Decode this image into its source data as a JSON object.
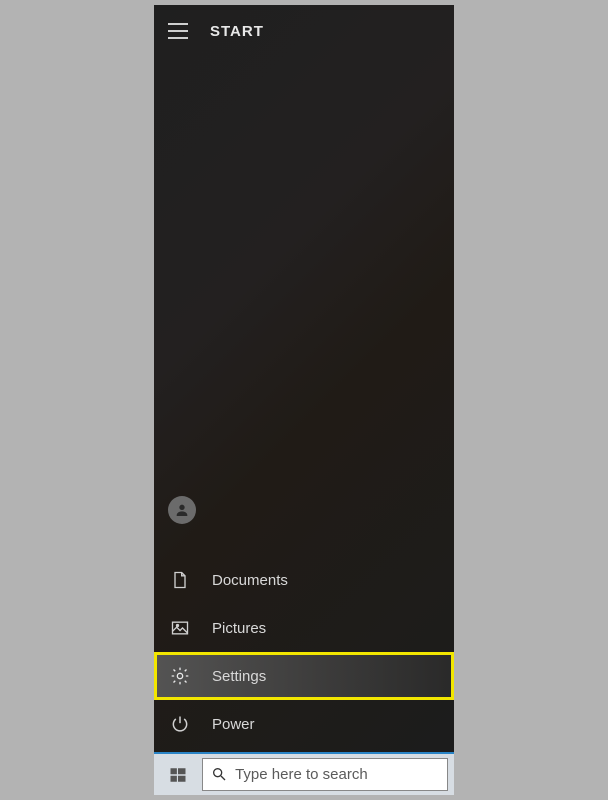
{
  "header": {
    "title": "START"
  },
  "rail": {
    "documents": "Documents",
    "pictures": "Pictures",
    "settings": "Settings",
    "power": "Power"
  },
  "search": {
    "placeholder": "Type here to search"
  }
}
